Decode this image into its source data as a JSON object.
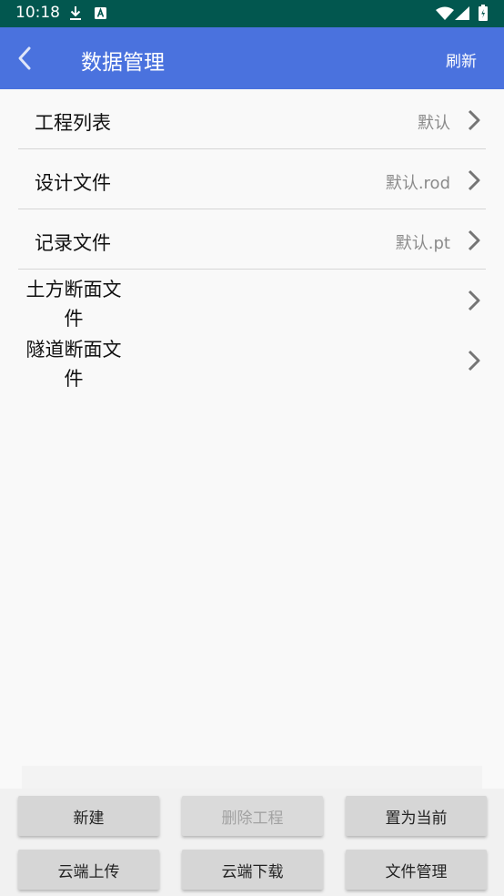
{
  "status_bar": {
    "time": "10:18",
    "icons": [
      "download-icon",
      "app-notification-icon",
      "wifi-icon",
      "signal-icon",
      "battery-icon"
    ]
  },
  "app_bar": {
    "title": "数据管理",
    "refresh_label": "刷新",
    "color": "#4a72de"
  },
  "list": {
    "items": [
      {
        "label": "工程列表",
        "value": "默认"
      },
      {
        "label": "设计文件",
        "value": "默认.rod"
      },
      {
        "label": "记录文件",
        "value": "默认.pt"
      },
      {
        "label_line1": "土方断面文",
        "label_line2": "件"
      },
      {
        "label_line1": "隧道断面文",
        "label_line2": "件"
      }
    ]
  },
  "buttons": {
    "new": "新建",
    "delete_project": "删除工程",
    "set_current": "置为当前",
    "cloud_upload": "云端上传",
    "cloud_download": "云端下载",
    "file_manage": "文件管理"
  }
}
